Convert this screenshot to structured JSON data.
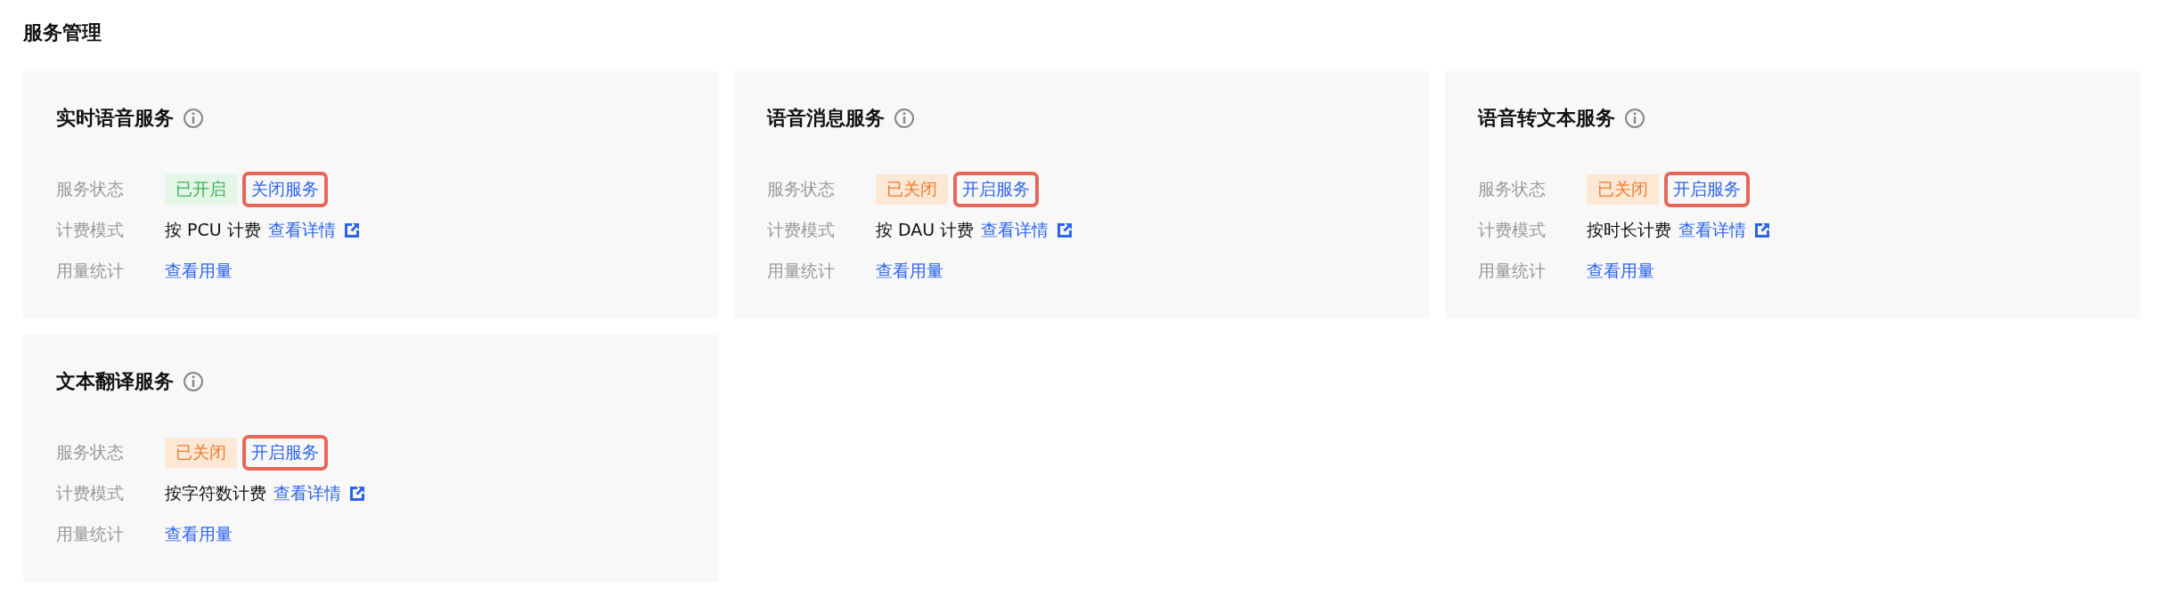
{
  "page_title": "服务管理",
  "services": [
    {
      "name": "实时语音服务",
      "status_label": "服务状态",
      "status": {
        "text": "已开启",
        "on": true
      },
      "action": {
        "text": "关闭服务",
        "highlighted": true
      },
      "billing_label": "计费模式",
      "billing": "按 PCU 计费",
      "details_link": "查看详情",
      "usage_label": "用量统计",
      "usage_link": "查看用量"
    },
    {
      "name": "语音消息服务",
      "status_label": "服务状态",
      "status": {
        "text": "已关闭",
        "on": false
      },
      "action": {
        "text": "开启服务",
        "highlighted": true
      },
      "billing_label": "计费模式",
      "billing": "按 DAU 计费",
      "details_link": "查看详情",
      "usage_label": "用量统计",
      "usage_link": "查看用量"
    },
    {
      "name": "语音转文本服务",
      "status_label": "服务状态",
      "status": {
        "text": "已关闭",
        "on": false
      },
      "action": {
        "text": "开启服务",
        "highlighted": true
      },
      "billing_label": "计费模式",
      "billing": "按时长计费",
      "details_link": "查看详情",
      "usage_label": "用量统计",
      "usage_link": "查看用量"
    },
    {
      "name": "文本翻译服务",
      "status_label": "服务状态",
      "status": {
        "text": "已关闭",
        "on": false
      },
      "action": {
        "text": "开启服务",
        "highlighted": true
      },
      "billing_label": "计费模式",
      "billing": "按字符数计费",
      "details_link": "查看详情",
      "usage_label": "用量统计",
      "usage_link": "查看用量"
    }
  ]
}
